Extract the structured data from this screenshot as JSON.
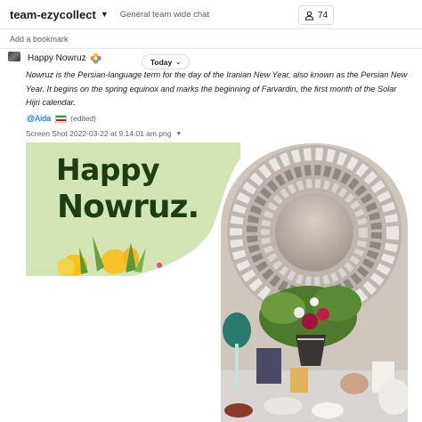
{
  "header": {
    "channel_name": "team-ezycollect",
    "topic": "General team wide chat",
    "member_count": "74"
  },
  "bookmarks": {
    "add_label": "Add a bookmark"
  },
  "divider": {
    "label": "Today"
  },
  "message": {
    "title": "Happy Nowruz",
    "body": "Nowruz is the Persian-language term for the day of the Iranian New Year, also known as the Persian New Year. It begins on the spring equinox and marks the beginning of Farvardin, the first month of the Solar Hijri calendar.",
    "mention": "@Aida",
    "edited_label": "(edited)",
    "attachment_name": "Screen Shot 2022-03-22 at 9.14.01 am.png"
  },
  "attachment_image": {
    "text_line_1": "Happy",
    "text_line_2": "Nowruz."
  },
  "colors": {
    "card_green": "#d3e4b5",
    "card_text": "#1f3d12",
    "mention_bg": "#e8f5fa",
    "mention_fg": "#1264a3",
    "flag_green": "#239f40",
    "flag_white": "#ffffff",
    "flag_red": "#da0000"
  },
  "icons": [
    "chevron-down-icon",
    "person-icon",
    "flower-emoji-icon",
    "iran-flag-icon"
  ]
}
